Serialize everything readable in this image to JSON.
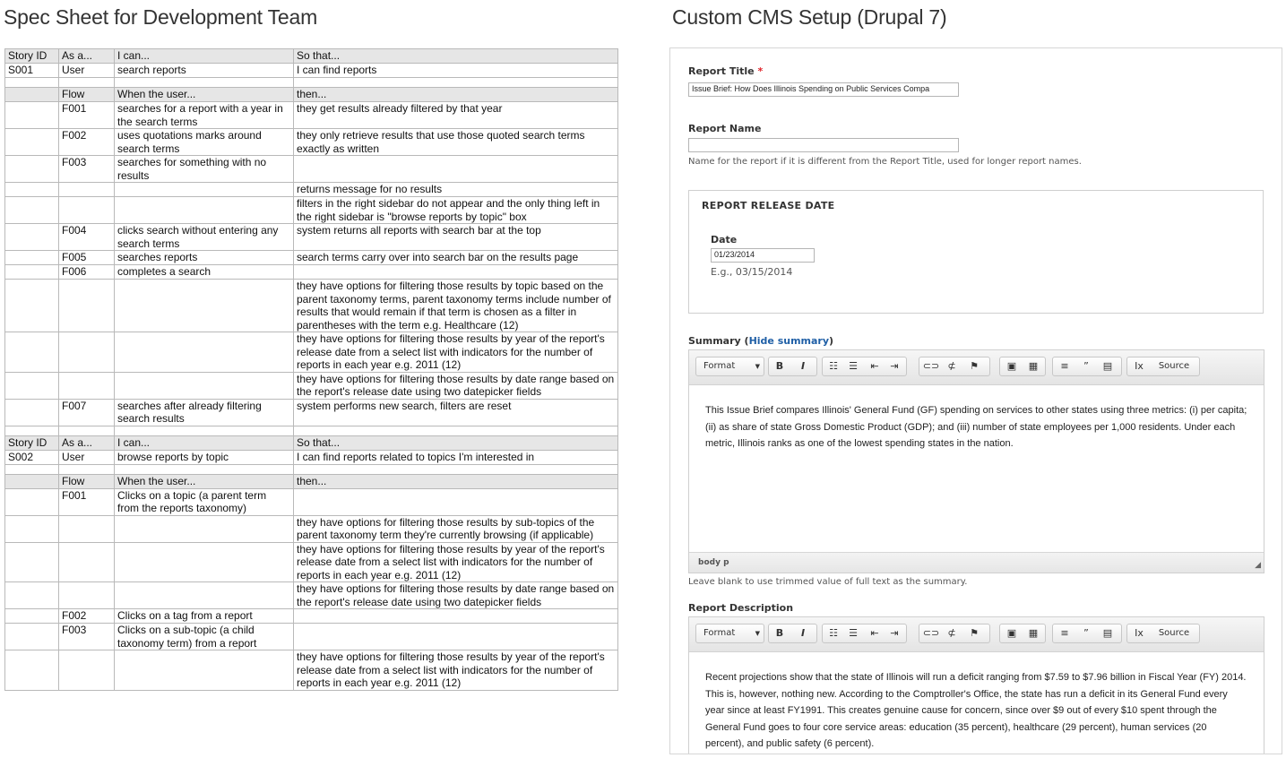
{
  "left_heading": "Spec Sheet for Development Team",
  "right_heading": "Custom CMS Setup (Drupal 7)",
  "spec_rows": [
    {
      "type": "hdr",
      "cells": [
        "Story ID",
        "As a...",
        "I can...",
        "So that..."
      ]
    },
    {
      "type": "data",
      "cells": [
        "S001",
        "User",
        "search reports",
        "I can find reports"
      ]
    },
    {
      "type": "blank",
      "cells": [
        "",
        "",
        "",
        ""
      ]
    },
    {
      "type": "hdr",
      "cells": [
        "",
        "Flow",
        "When the user...",
        "then..."
      ]
    },
    {
      "type": "data",
      "cells": [
        "",
        "F001",
        "searches for a report with a year in the search terms",
        "they get results already filtered by that year"
      ]
    },
    {
      "type": "data",
      "cells": [
        "",
        "F002",
        "uses quotations marks around search terms",
        "they only retrieve results that use those quoted search terms exactly as written"
      ]
    },
    {
      "type": "data",
      "cells": [
        "",
        "F003",
        "searches for something with no results",
        ""
      ]
    },
    {
      "type": "data",
      "cells": [
        "",
        "",
        "",
        "returns message for no results"
      ]
    },
    {
      "type": "data",
      "cells": [
        "",
        "",
        "",
        "filters in the right sidebar do not appear and the only thing left in the right sidebar is \"browse reports by topic\" box"
      ]
    },
    {
      "type": "data",
      "cells": [
        "",
        "F004",
        "clicks search without entering any search terms",
        "system returns all reports with search bar at the top"
      ]
    },
    {
      "type": "data",
      "cells": [
        "",
        "F005",
        "searches reports",
        "search terms carry over into search bar on the results page"
      ]
    },
    {
      "type": "data",
      "cells": [
        "",
        "F006",
        "completes a search",
        ""
      ]
    },
    {
      "type": "data",
      "cells": [
        "",
        "",
        "",
        "they have options for filtering those results by topic based on the parent taxonomy terms, parent taxonomy terms include number of results that would remain if that term is chosen as a filter in parentheses with the term e.g. Healthcare (12)"
      ]
    },
    {
      "type": "data",
      "cells": [
        "",
        "",
        "",
        "they have options for filtering those results by year of the report's release date from a select list with indicators for the number of reports in each year e.g. 2011 (12)"
      ]
    },
    {
      "type": "data",
      "cells": [
        "",
        "",
        "",
        "they have options for filtering those results by date range based on the report's release date using two datepicker fields"
      ]
    },
    {
      "type": "data",
      "cells": [
        "",
        "F007",
        "searches after already filtering search results",
        "system performs new search, filters are reset"
      ]
    },
    {
      "type": "blank",
      "cells": [
        "",
        "",
        "",
        ""
      ]
    },
    {
      "type": "hdr",
      "cells": [
        "Story ID",
        "As a...",
        "I can...",
        "So that..."
      ]
    },
    {
      "type": "data",
      "cells": [
        "S002",
        "User",
        "browse reports by topic",
        "I can find reports related to topics I'm interested in"
      ]
    },
    {
      "type": "blank",
      "cells": [
        "",
        "",
        "",
        ""
      ]
    },
    {
      "type": "hdr",
      "cells": [
        "",
        "Flow",
        "When the user...",
        "then..."
      ]
    },
    {
      "type": "data",
      "cells": [
        "",
        "F001",
        "Clicks on a topic (a parent term from the reports taxonomy)",
        ""
      ]
    },
    {
      "type": "data",
      "cells": [
        "",
        "",
        "",
        "they have options for filtering those results by sub-topics of the parent taxonomy term they're currently browsing (if applicable)"
      ]
    },
    {
      "type": "data",
      "cells": [
        "",
        "",
        "",
        "they have options for filtering those results by year of the report's release date from a select list with indicators for the number of reports in each year e.g. 2011 (12)"
      ]
    },
    {
      "type": "data",
      "cells": [
        "",
        "",
        "",
        "they have options for filtering those results by date range based on the report's release date using two datepicker fields"
      ]
    },
    {
      "type": "data",
      "cells": [
        "",
        "F002",
        "Clicks on a tag from a report",
        ""
      ]
    },
    {
      "type": "data",
      "cells": [
        "",
        "F003",
        "Clicks on a sub-topic (a child taxonomy term) from a report",
        ""
      ]
    },
    {
      "type": "data",
      "cells": [
        "",
        "",
        "",
        "they have options for filtering those results by year of the report's release date from a select list with indicators for the number of reports in each year e.g. 2011 (12)"
      ]
    }
  ],
  "cms": {
    "report_title_label": "Report Title",
    "required_marker": "*",
    "report_title_value": "Issue Brief: How Does Illinois Spending on Public Services Compa",
    "report_name_label": "Report Name",
    "report_name_value": "",
    "report_name_help": "Name for the report if it is different from the Report Title, used for longer report names.",
    "release_legend": "REPORT RELEASE DATE",
    "date_label": "Date",
    "date_value": "01/23/2014",
    "date_example": "E.g., 03/15/2014",
    "summary_label": "Summary (",
    "hide_summary_link": "Hide summary",
    "summary_close": ")",
    "summary_text": "This Issue Brief compares Illinois' General Fund (GF) spending on services to other states using three metrics: (i) per capita; (ii) as share of state Gross Domestic Product (GDP); and (iii) number of state employees per 1,000 residents. Under each metric, Illinois ranks as one of the lowest spending states in the nation.",
    "summary_status_path": "body  p",
    "summary_help": "Leave blank to use trimmed value of full text as the summary.",
    "description_label": "Report Description",
    "description_text": "Recent projections show that the state of Illinois will run a deficit ranging from $7.59 to $7.96 billion in Fiscal Year (FY) 2014. This is, however, nothing new. According to the Comptroller's Office, the state has run a deficit in its General Fund every year since at least FY1991. This creates genuine cause for concern, since over $9 out of every $10 spent through the General Fund goes to four core service areas: education (35 percent), healthcare (29 percent), human services (20 percent), and public safety (6 percent).",
    "toolbar": {
      "format": "Format",
      "bold": "B",
      "italic": "I",
      "bullet_list": "☷",
      "numbered_list": "☰",
      "outdent": "⇤",
      "indent": "⇥",
      "link": "⊂⊃",
      "unlink": "⊄",
      "anchor": "⚑",
      "image": "▣",
      "media": "▦",
      "hr": "≡",
      "blockquote": "”",
      "table": "▤",
      "remove_format": "Ix",
      "source": "Source"
    }
  }
}
